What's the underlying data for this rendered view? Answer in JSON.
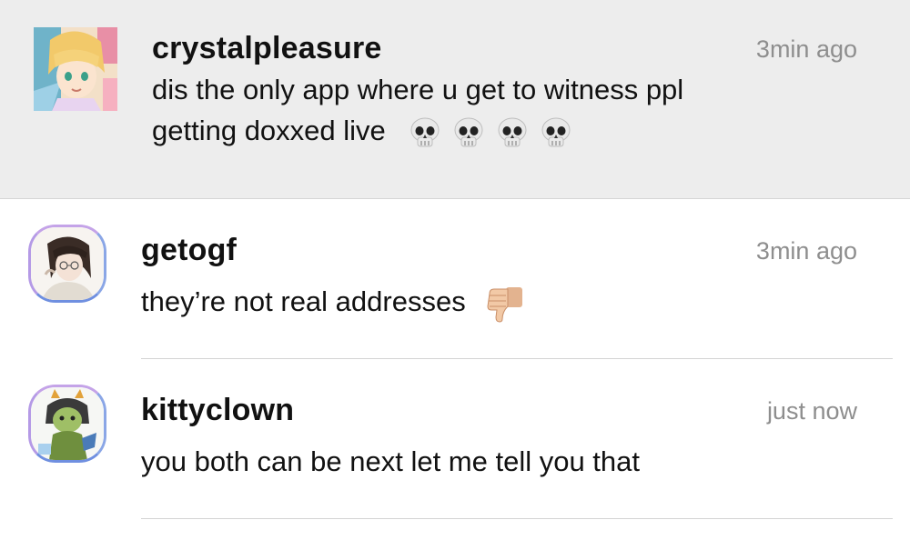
{
  "comments": [
    {
      "username": "crystalpleasure",
      "timestamp": "3min ago",
      "line1": "dis the only app where u get to witness ppl",
      "line2": "getting doxxed live",
      "emoji": [
        "skull-emoji",
        "skull-emoji",
        "skull-emoji",
        "skull-emoji"
      ],
      "highlighted": true
    },
    {
      "username": "getogf",
      "timestamp": "3min ago",
      "text": "they’re not real addresses",
      "emoji": [
        "thumbs-down-emoji"
      ]
    },
    {
      "username": "kittyclown",
      "timestamp": "just now",
      "text": "you both can be next let me tell you that"
    }
  ],
  "colors": {
    "highlight_background": "#ededed",
    "timestamp": "#8e8e8e",
    "text": "#111111",
    "avatar_ring": "#8aa6e6"
  }
}
